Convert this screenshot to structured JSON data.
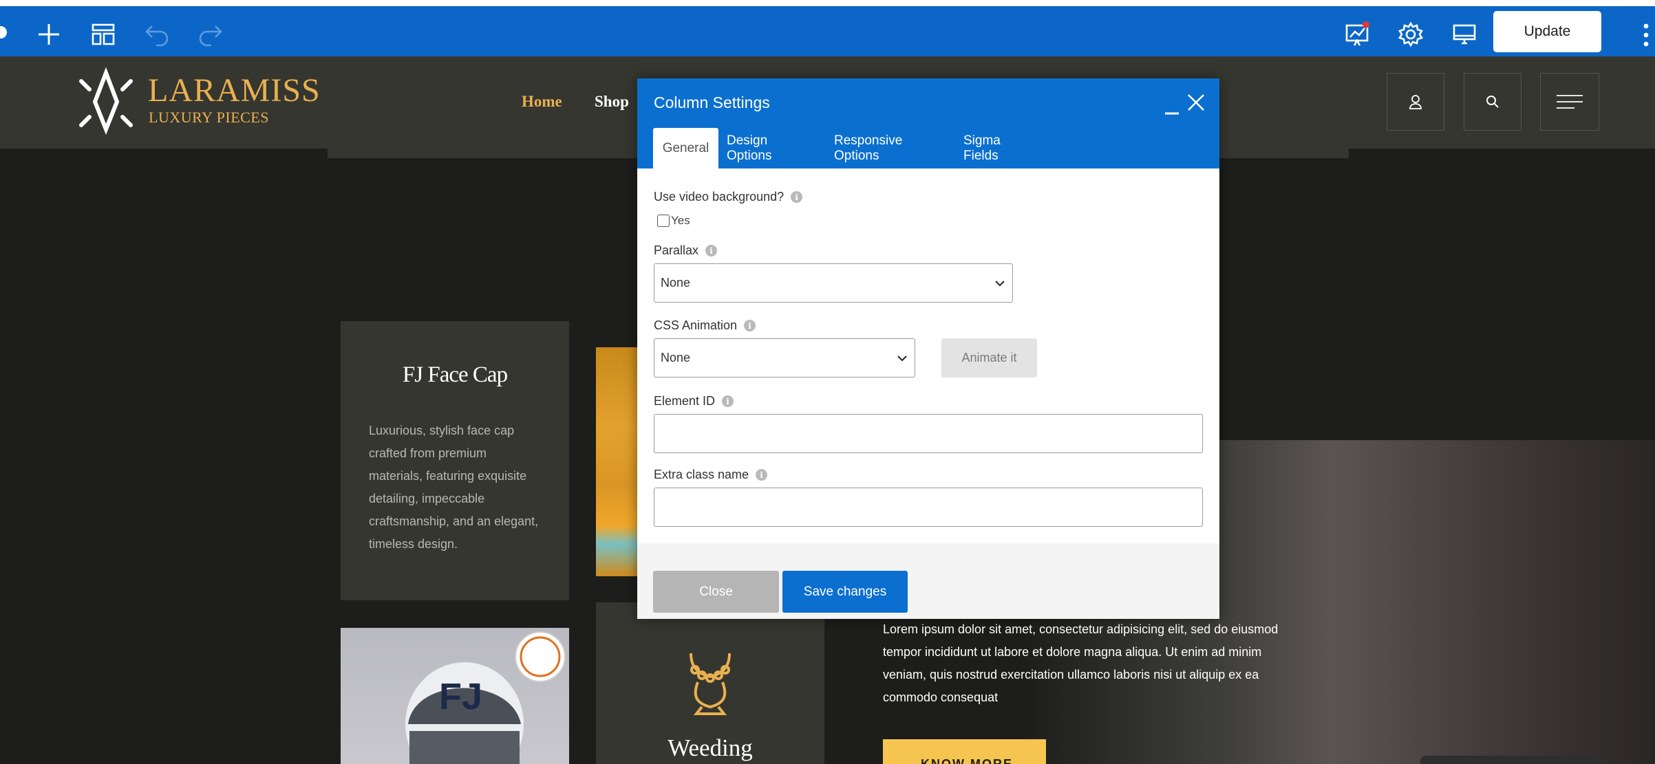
{
  "toolbar": {
    "update_label": "Update",
    "icons": [
      "plus-icon",
      "layout-icon",
      "undo-icon",
      "redo-icon",
      "analytics-icon",
      "gear-icon",
      "desktop-icon",
      "more-vertical-icon"
    ]
  },
  "brand": {
    "name": "LARAMISS",
    "tagline": "LUXURY PIECES"
  },
  "nav": {
    "home": "Home",
    "shop": "Shop"
  },
  "cards": {
    "cap_title": "FJ Face Cap",
    "cap_desc": "Luxurious, stylish face cap crafted from premium materials, featuring exquisite detailing, impeccable craftsmanship, and an elegant, timeless design.",
    "wedding_title": "Weeding"
  },
  "hero": {
    "text": "Lorem ipsum dolor sit amet, consectetur adipisicing elit, sed do eiusmod tempor incididunt ut labore et dolore magna aliqua. Ut enim ad minim veniam, quis nostrud exercitation ullamco laboris nisi ut aliquip ex ea commodo consequat",
    "button": "KNOW MORE"
  },
  "modal": {
    "title": "Column Settings",
    "tabs": [
      "General",
      "Design Options",
      "Responsive Options",
      "Sigma Fields"
    ],
    "video_label": "Use video background?",
    "video_yes": "Yes",
    "parallax_label": "Parallax",
    "parallax_value": "None",
    "animation_label": "CSS Animation",
    "animation_value": "None",
    "animate_button": "Animate it",
    "element_id_label": "Element ID",
    "element_id_value": "",
    "extra_class_label": "Extra class name",
    "extra_class_value": "",
    "close_button": "Close",
    "save_button": "Save changes",
    "info_glyph": "i"
  },
  "colors": {
    "editor_blue": "#0b66c8",
    "modal_blue": "#0b6fd0",
    "gold": "#e8b14f",
    "dark_bg": "#1d1d1b",
    "card_bg": "#363630"
  }
}
